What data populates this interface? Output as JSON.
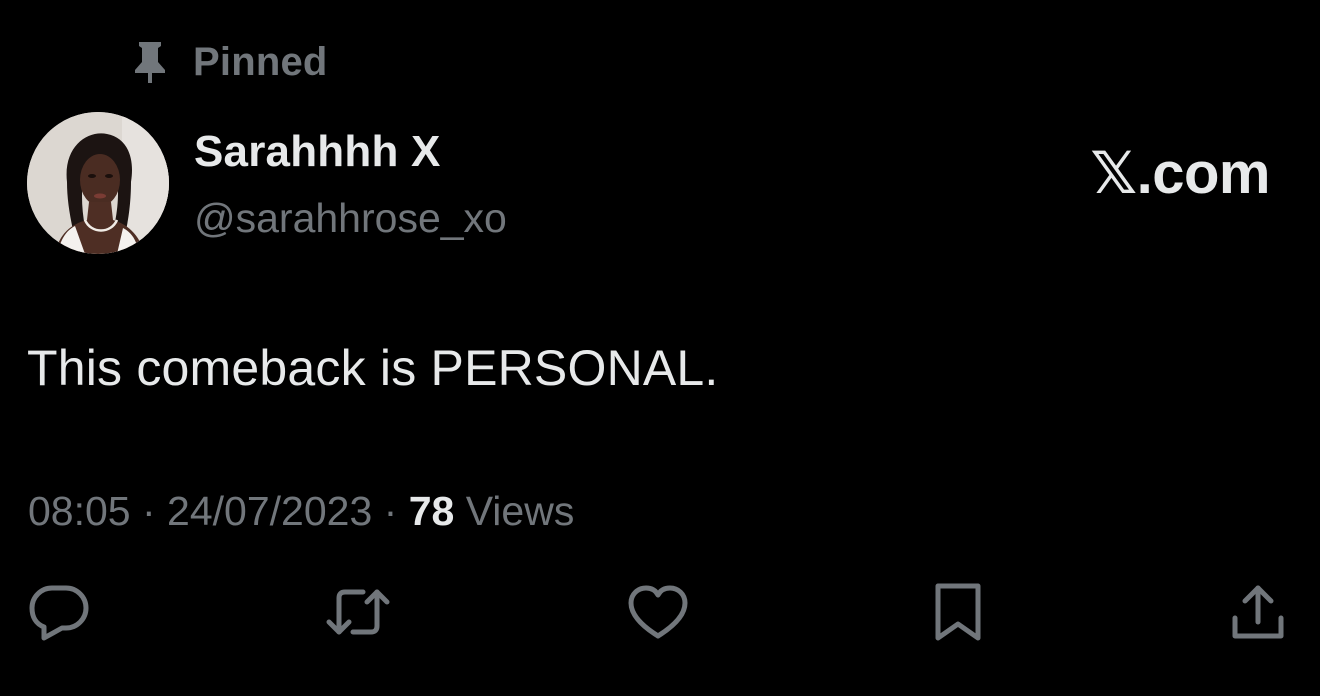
{
  "pinned": {
    "label": "Pinned",
    "icon": "pin-icon"
  },
  "author": {
    "display_name": "Sarahhhh X",
    "handle": "@sarahhrose_xo"
  },
  "brand": {
    "text": "𝕏.com"
  },
  "tweet": {
    "text": "This comeback is PERSONAL.",
    "time": "08:05",
    "separator_1": " · ",
    "date": "24/07/2023",
    "separator_2": " · ",
    "views_count": "78",
    "views_label": " Views"
  },
  "actions": [
    {
      "name": "reply",
      "icon": "reply-icon"
    },
    {
      "name": "retweet",
      "icon": "retweet-icon"
    },
    {
      "name": "like",
      "icon": "heart-icon"
    },
    {
      "name": "bookmark",
      "icon": "bookmark-icon"
    },
    {
      "name": "share",
      "icon": "share-icon"
    }
  ],
  "colors": {
    "background": "#000000",
    "primary_text": "#e7e9ea",
    "secondary_text": "#71767b"
  }
}
